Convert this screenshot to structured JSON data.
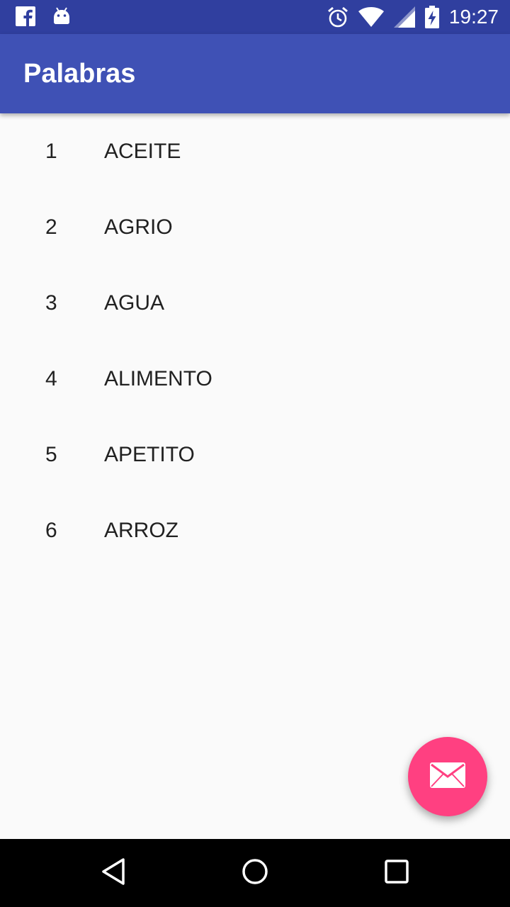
{
  "status_bar": {
    "time": "19:27",
    "left_icons": [
      "facebook-icon",
      "android-icon"
    ],
    "right_icons": [
      "alarm-icon",
      "wifi-icon",
      "cell-signal-icon",
      "battery-charging-icon"
    ]
  },
  "app_bar": {
    "title": "Palabras"
  },
  "words": [
    {
      "num": "1",
      "word": "ACEITE"
    },
    {
      "num": "2",
      "word": "AGRIO"
    },
    {
      "num": "3",
      "word": "AGUA"
    },
    {
      "num": "4",
      "word": "ALIMENTO"
    },
    {
      "num": "5",
      "word": "APETITO"
    },
    {
      "num": "6",
      "word": "ARROZ"
    }
  ],
  "fab": {
    "icon": "email-icon"
  },
  "nav_bar": {
    "icons": [
      "back-icon",
      "home-icon",
      "recents-icon"
    ]
  },
  "colors": {
    "status_bar": "#303f9f",
    "app_bar": "#3f51b5",
    "fab": "#ff4081",
    "background": "#fafafa",
    "text": "#212121"
  }
}
